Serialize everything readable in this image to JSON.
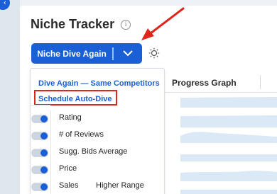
{
  "page": {
    "title": "Niche Tracker"
  },
  "toolbar": {
    "dive_button_label": "Niche Dive Again"
  },
  "dropdown": {
    "items": [
      {
        "label": "Dive Again — Same Competitors"
      },
      {
        "label": "Schedule Auto-Dive"
      }
    ]
  },
  "table": {
    "progress_header": "Progress Graph",
    "metrics": [
      {
        "label": "Rating",
        "extra": ""
      },
      {
        "label": "# of Reviews",
        "extra": ""
      },
      {
        "label": "Sugg. Bids Average",
        "extra": ""
      },
      {
        "label": "Price",
        "extra": ""
      },
      {
        "label": "Sales",
        "extra": "Higher Range"
      }
    ]
  },
  "colors": {
    "accent": "#1a5fd6",
    "annotation": "#e0251b"
  },
  "icons": [
    "chevron-left-icon",
    "info-icon",
    "chevron-down-icon",
    "lightbulb-icon",
    "arrow-annotation"
  ]
}
